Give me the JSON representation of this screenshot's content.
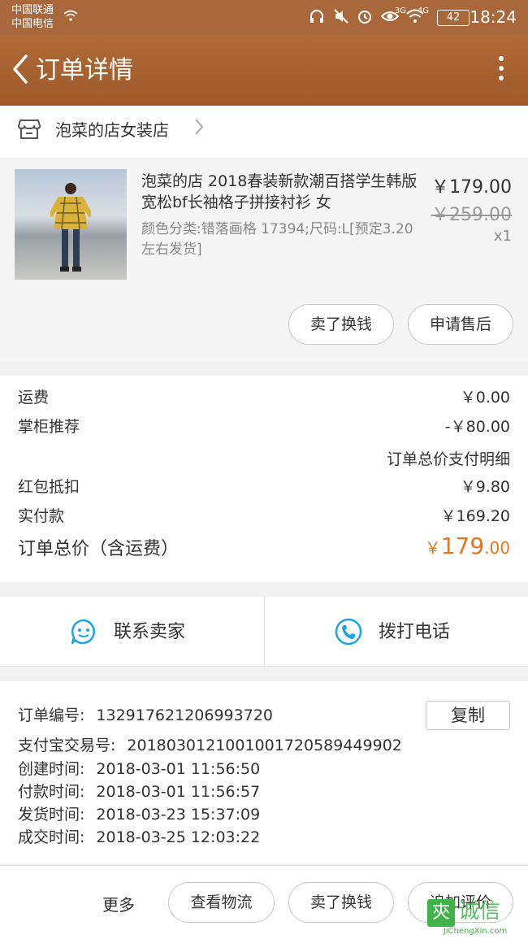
{
  "status_bar": {
    "carrier1": "中国联通",
    "carrier2": "中国电信",
    "net1": "3G",
    "net2": "4G",
    "battery": "42",
    "time": "18:24"
  },
  "header": {
    "title": "订单详情"
  },
  "shop": {
    "name": "泡菜的店女装店"
  },
  "item": {
    "title": "泡菜的店 2018春装新款潮百搭学生韩版宽松bf长袖格子拼接衬衫 女",
    "sku": "颜色分类:错落画格 17394;尺码:L[预定3.20左右发货]",
    "price": "￥179.00",
    "original_price": "￥259.00",
    "quantity": "x1",
    "sell_button": "卖了换钱",
    "aftersale_button": "申请售后"
  },
  "fees": {
    "shipping_label": "运费",
    "shipping_value": "￥0.00",
    "recommend_label": "掌柜推荐",
    "recommend_value": "-￥80.00",
    "payment_detail_link": "订单总价支付明细",
    "redpacket_label": "红包抵扣",
    "redpacket_value": "￥9.80",
    "paid_label": "实付款",
    "paid_value": "￥169.20",
    "total_label": "订单总价（含运费）",
    "total_currency": "￥",
    "total_int": "179",
    "total_dec": ".00"
  },
  "contact": {
    "seller_label": "联系卖家",
    "call_label": "拨打电话"
  },
  "order_info": {
    "copy_button": "复制",
    "rows": [
      {
        "label": "订单编号:",
        "value": "132917621206993720"
      },
      {
        "label": "支付宝交易号:",
        "value": "2018030121001001720589449902"
      },
      {
        "label": "创建时间:",
        "value": "2018-03-01 11:56:50"
      },
      {
        "label": "付款时间:",
        "value": "2018-03-01 11:56:57"
      },
      {
        "label": "发货时间:",
        "value": "2018-03-23 15:37:09"
      },
      {
        "label": "成交时间:",
        "value": "2018-03-25 12:03:22"
      }
    ]
  },
  "bottom_bar": {
    "more": "更多",
    "logistics": "查看物流",
    "sell": "卖了换钱",
    "review": "追加评价"
  },
  "watermark": {
    "logo": "㚒",
    "text": "诚信",
    "sub": "JiChengXin.com"
  },
  "colors": {
    "header": "#a8683b",
    "accent_price": "#e8741e",
    "contact_icon": "#1aa6e6"
  }
}
